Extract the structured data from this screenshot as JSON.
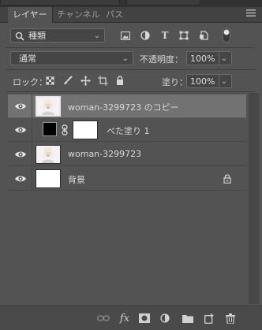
{
  "tabs": [
    {
      "label": "レイヤー",
      "active": true
    },
    {
      "label": "チャンネル",
      "active": false
    },
    {
      "label": "パス",
      "active": false
    }
  ],
  "filter": {
    "kind_label": "種類",
    "icons": [
      "image-filter-icon",
      "adjustment-filter-icon",
      "type-filter-icon",
      "shape-filter-icon",
      "smart-object-filter-icon",
      "filter-toggle-icon"
    ]
  },
  "blend": {
    "mode": "通常",
    "opacity_label": "不透明度：",
    "opacity_value": "100%"
  },
  "lock": {
    "label": "ロック：",
    "fill_label": "塗り：",
    "fill_value": "100%"
  },
  "layers": [
    {
      "name": "woman-3299723 のコピー",
      "selected": true,
      "type": "image",
      "locked": false
    },
    {
      "name": "べた塗り 1",
      "selected": false,
      "type": "fill",
      "locked": false
    },
    {
      "name": "woman-3299723",
      "selected": false,
      "type": "image",
      "locked": false
    },
    {
      "name": "背景",
      "selected": false,
      "type": "background",
      "locked": true
    }
  ],
  "colors": {
    "panel_bg": "#535353",
    "selected_row": "#727272",
    "fill_color": "#000000",
    "mask_color": "#ffffff"
  }
}
